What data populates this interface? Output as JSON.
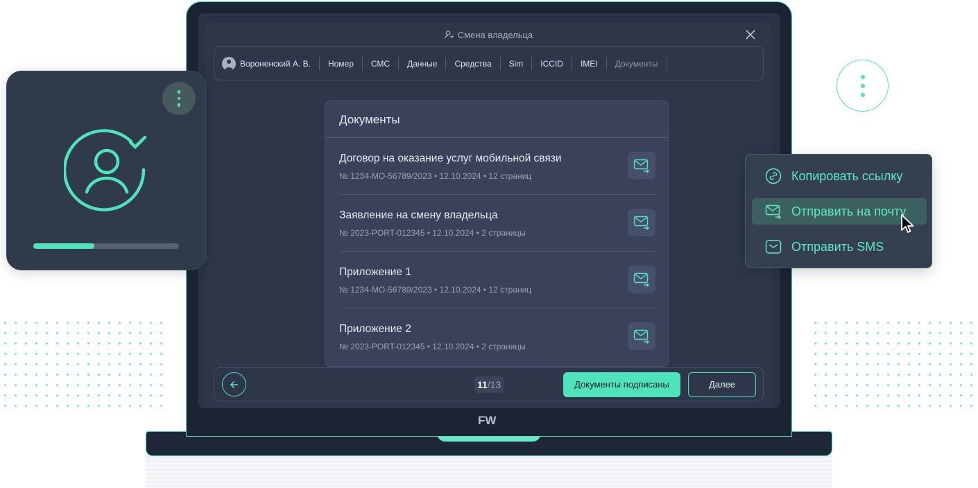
{
  "window": {
    "title": "Смена владельца"
  },
  "tabs": {
    "owner": "Вороненский А. В.",
    "items": [
      "Номер",
      "СМС",
      "Данные",
      "Средства",
      "Sim",
      "ICCID",
      "IMEI"
    ],
    "current": "Документы"
  },
  "documents": {
    "heading": "Документы",
    "items": [
      {
        "name": "Договор на оказание услуг мобильной связи",
        "meta": "№ 1234-МО-56789/2023  •  12.10.2024  •  12 страниц"
      },
      {
        "name": "Заявление на смену владельца",
        "meta": "№ 2023-PORT-012345  •  12.10.2024  •  2 страницы"
      },
      {
        "name": "Приложение 1",
        "meta": "№ 1234-МО-56789/2023  •  12.10.2024  •  12 страниц"
      },
      {
        "name": "Приложение 2",
        "meta": "№ 2023-PORT-012345  •  12.10.2024  •  2 страницы"
      }
    ]
  },
  "footer": {
    "page_current": "11",
    "page_total": "/13",
    "signed_label": "Документы подписаны",
    "next_label": "Далее"
  },
  "brand": {
    "logo": "FW"
  },
  "card": {
    "progress": 0.42
  },
  "menu": {
    "items": [
      {
        "label": "Копировать ссылку",
        "icon": "link-icon"
      },
      {
        "label": "Отправить на почту",
        "icon": "mail-send-icon"
      },
      {
        "label": "Отправить SMS",
        "icon": "sms-icon"
      }
    ],
    "active_index": 1
  },
  "colors": {
    "accent": "#4fe3bc",
    "panel": "#394259",
    "screen": "#2e374a"
  }
}
